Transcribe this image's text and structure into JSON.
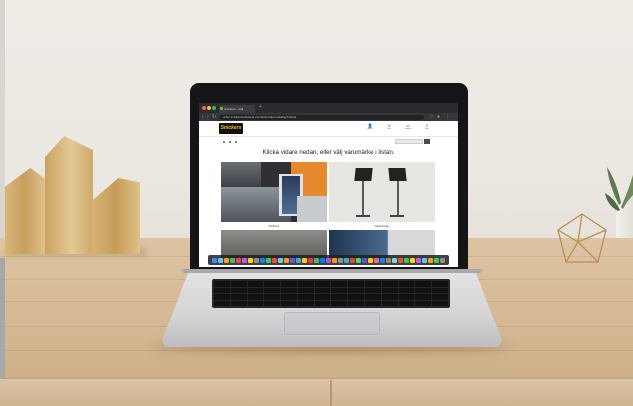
{
  "browser": {
    "tab_title": "Snickers - Välj",
    "url": "order.snickersworkwear.com/sv/product-catalog/brands",
    "traffic_colors": [
      "#ff5f57",
      "#febc2e",
      "#28c840"
    ]
  },
  "site": {
    "logo_text": "Snickers",
    "header_icons": [
      {
        "icon": "user-icon",
        "caption": "Logga in"
      },
      {
        "icon": "share-icon",
        "caption": "Dela"
      },
      {
        "icon": "cart-icon",
        "caption": "Varukorg"
      },
      {
        "icon": "menu-icon",
        "caption": "Meny"
      }
    ],
    "headline": "Klicka vidare nedan, eller välj varumärke i listan.",
    "tiles": [
      {
        "caption": "Workwear"
      },
      {
        "caption": "Digital display"
      }
    ],
    "accent_color": "#f0c419"
  },
  "dock_colors": [
    "#3d8bfd",
    "#5ac8fa",
    "#ff9f0a",
    "#34c759",
    "#ff375f",
    "#bf5af2",
    "#ffd60a",
    "#8e8e93",
    "#0a84ff",
    "#30d158",
    "#ff453a",
    "#64d2ff",
    "#ff9f0a",
    "#5e5ce6",
    "#32ade6",
    "#ffcc00",
    "#ff2d55",
    "#34c759",
    "#007aff",
    "#af52de",
    "#ff9500",
    "#8e8e93",
    "#30b0c7",
    "#ff3b30",
    "#4cd964",
    "#5856d6",
    "#ffcc00",
    "#ff6482",
    "#0a84ff",
    "#a2845e",
    "#63e6e2",
    "#ff453a",
    "#34c759",
    "#ffd60a",
    "#bf5af2",
    "#5ac8fa",
    "#ff9f0a",
    "#30d158",
    "#8e8e93"
  ]
}
